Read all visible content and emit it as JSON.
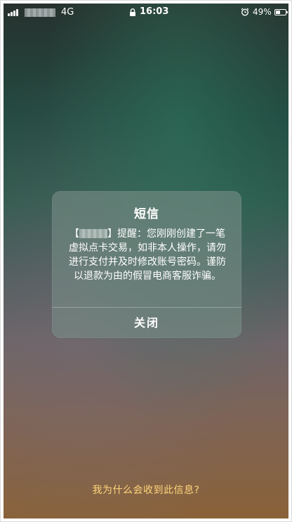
{
  "status_bar": {
    "network": "4G",
    "time": "16:03",
    "battery_percent": "49%",
    "battery_level": 0.49,
    "icons": [
      "signal-icon",
      "lock-icon",
      "alarm-icon",
      "battery-icon"
    ]
  },
  "dialog": {
    "title": "短信",
    "message_open_bracket": "【",
    "message_close_bracket": "】",
    "message_body": "提醒：您刚刚创建了一笔虚拟点卡交易，如非本人操作，请勿进行支付并及时修改账号密码。谨防以退款为由的假冒电商客服诈骗。",
    "close_label": "关闭"
  },
  "footer": {
    "why_link": "我为什么会收到此信息?"
  },
  "colors": {
    "link": "#ffd57a",
    "dialog_background": "rgba(120,140,134,0.62)"
  }
}
